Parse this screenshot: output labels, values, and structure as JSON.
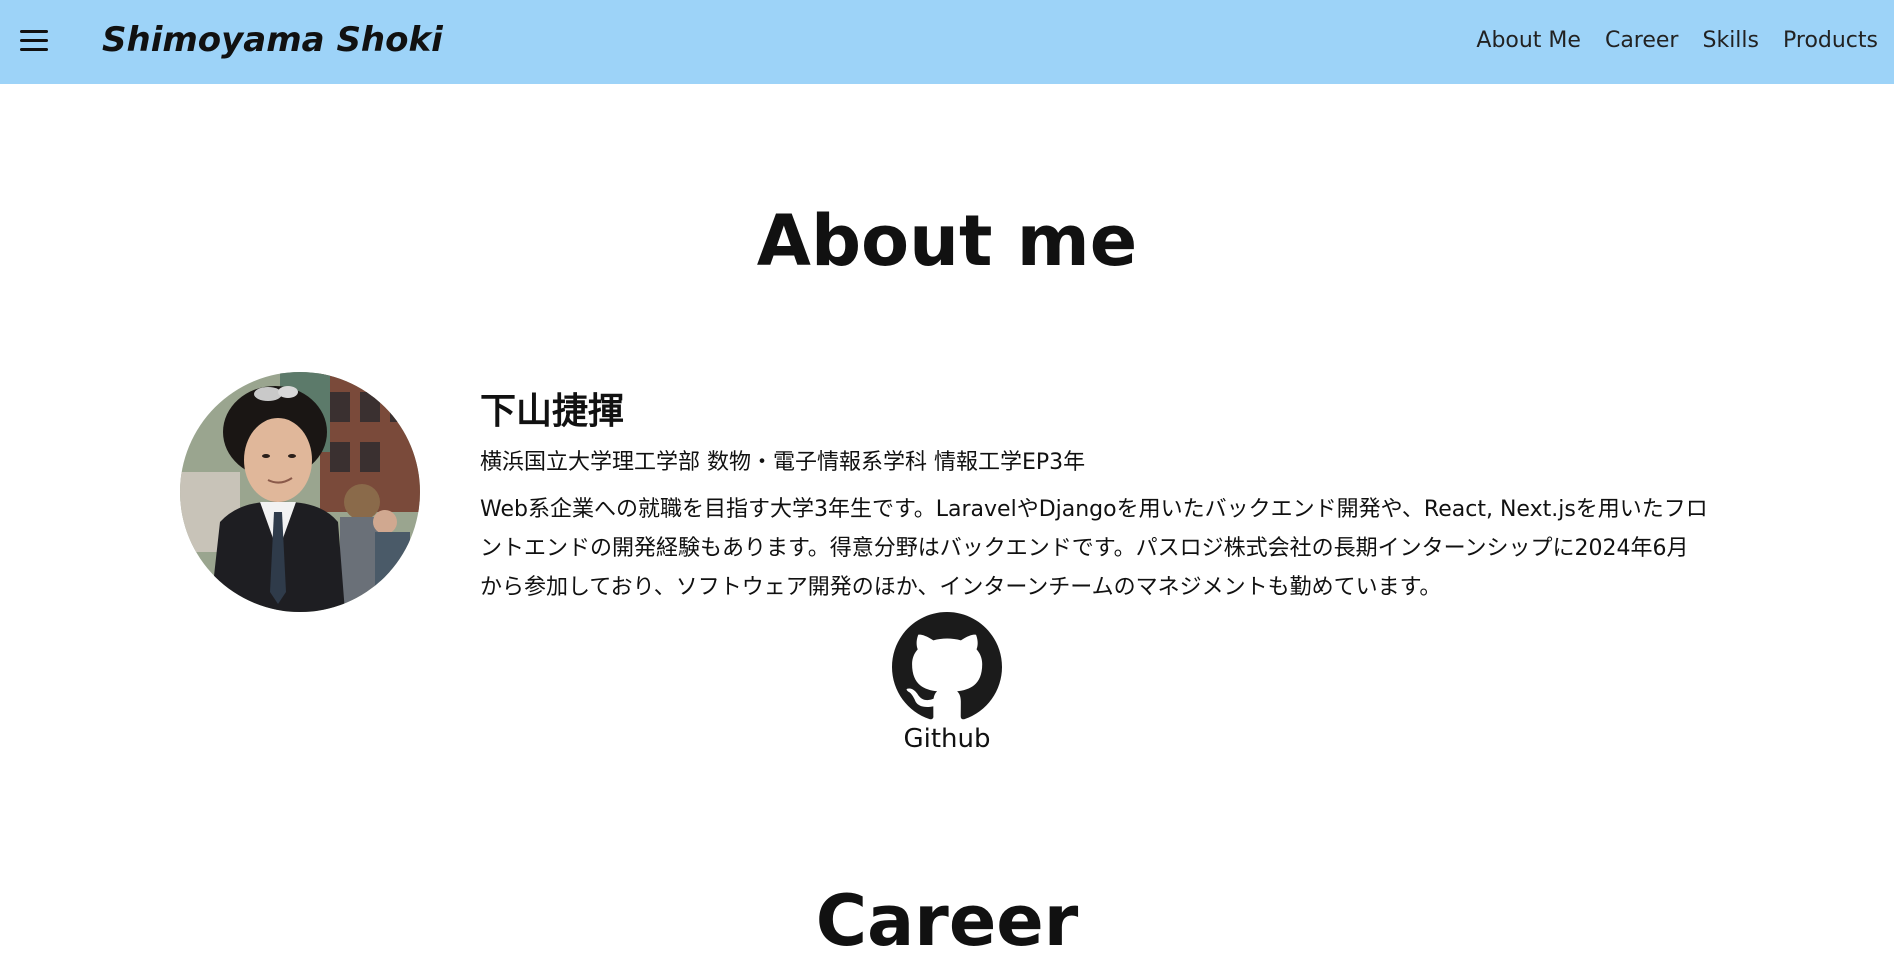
{
  "header": {
    "brand": "Shimoyama Shoki",
    "nav": [
      {
        "label": "About Me"
      },
      {
        "label": "Career"
      },
      {
        "label": "Skills"
      },
      {
        "label": "Products"
      }
    ],
    "menu_icon": "hamburger-menu-icon"
  },
  "about": {
    "title": "About me",
    "name": "下山捷揮",
    "affiliation": "横浜国立大学理工学部 数物・電子情報系学科 情報工学EP3年",
    "bio": "Web系企業への就職を目指す大学3年生です。LaravelやDjangoを用いたバックエンド開発や、React, Next.jsを用いたフロントエンドの開発経験もあります。得意分野はバックエンドです。パスロジ株式会社の長期インターンシップに2024年6月から参加しており、ソフトウェア開発のほか、インターンチームのマネジメントも勤めています。",
    "github_label": "Github",
    "github_icon": "github-icon"
  },
  "career": {
    "title": "Career"
  },
  "colors": {
    "header_bg": "#9dd3f8",
    "text": "#111111",
    "background": "#ffffff"
  }
}
